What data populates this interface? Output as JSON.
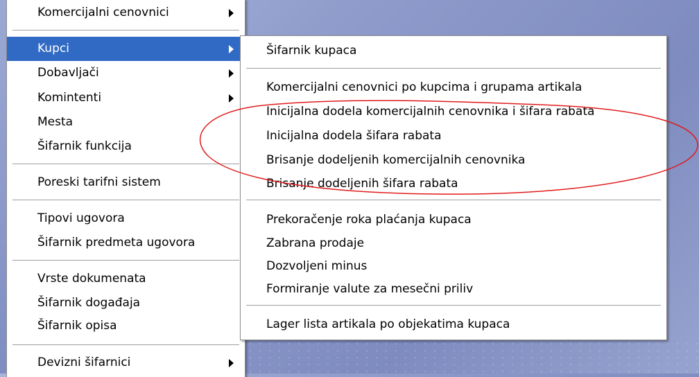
{
  "left_menu": {
    "items": [
      {
        "label": "Komercijalni cenovnici",
        "has_submenu": true
      },
      {
        "label": "Kupci",
        "has_submenu": true,
        "selected": true
      },
      {
        "label": "Dobavljači",
        "has_submenu": true
      },
      {
        "label": "Komintenti",
        "has_submenu": true
      },
      {
        "label": "Mesta",
        "has_submenu": false
      },
      {
        "label": "Šifarnik funkcija",
        "has_submenu": false
      },
      {
        "label": "Poreski tarifni sistem",
        "has_submenu": false
      },
      {
        "label": "Tipovi ugovora",
        "has_submenu": false
      },
      {
        "label": "Šifarnik predmeta ugovora",
        "has_submenu": false
      },
      {
        "label": "Vrste dokumenata",
        "has_submenu": false
      },
      {
        "label": "Šifarnik događaja",
        "has_submenu": false
      },
      {
        "label": "Šifarnik opisa",
        "has_submenu": false
      },
      {
        "label": "Devizni šifarnici",
        "has_submenu": true
      }
    ]
  },
  "sub_menu": {
    "items": [
      {
        "label": "Šifarnik kupaca"
      },
      {
        "label": "Komercijalni cenovnici po kupcima i grupama artikala"
      },
      {
        "label": "Inicijalna dodela komercijalnih cenovnika i šifara rabata"
      },
      {
        "label": "Inicijalna dodela šifara rabata"
      },
      {
        "label": "Brisanje dodeljenih komercijalnih cenovnika"
      },
      {
        "label": "Brisanje dodeljenih šifara rabata"
      },
      {
        "label": "Prekoračenje roka plaćanja kupaca"
      },
      {
        "label": "Zabrana prodaje"
      },
      {
        "label": "Dozvoljeni minus"
      },
      {
        "label": "Formiranje valute za mesečni priliv"
      },
      {
        "label": "Lager lista artikala po objekatima kupaca"
      }
    ]
  },
  "colors": {
    "selection": "#316ac5",
    "annotation": "#e01a1a",
    "desktop": "#8e9bcb"
  }
}
